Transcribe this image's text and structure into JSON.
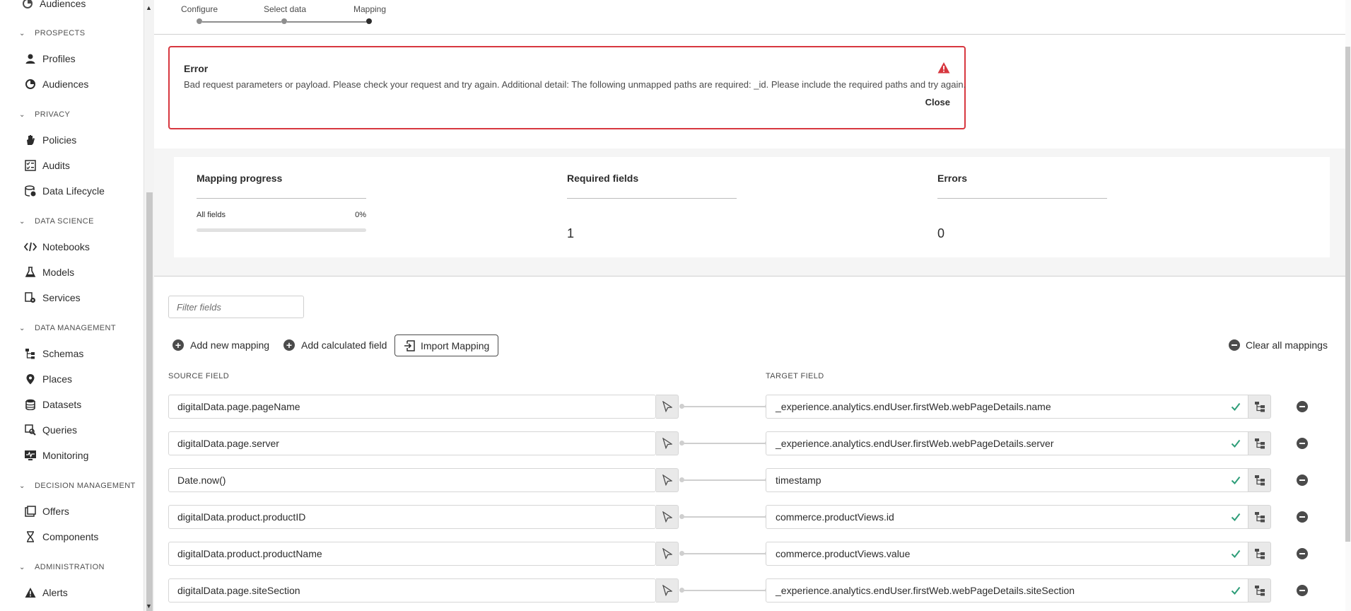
{
  "sidebar": {
    "top_item": "Audiences",
    "sections": [
      {
        "title": "PROSPECTS",
        "items": [
          "Profiles",
          "Audiences"
        ]
      },
      {
        "title": "PRIVACY",
        "items": [
          "Policies",
          "Audits",
          "Data Lifecycle"
        ]
      },
      {
        "title": "DATA SCIENCE",
        "items": [
          "Notebooks",
          "Models",
          "Services"
        ]
      },
      {
        "title": "DATA MANAGEMENT",
        "items": [
          "Schemas",
          "Places",
          "Datasets",
          "Queries",
          "Monitoring"
        ]
      },
      {
        "title": "DECISION MANAGEMENT",
        "items": [
          "Offers",
          "Components"
        ]
      },
      {
        "title": "ADMINISTRATION",
        "items": [
          "Alerts"
        ]
      }
    ]
  },
  "stepper": {
    "steps": [
      "Configure",
      "Select data",
      "Mapping"
    ],
    "active": "Mapping"
  },
  "error": {
    "title": "Error",
    "message": "Bad request parameters or payload. Please check your request and try again. Additional detail: The following unmapped paths are required: _id. Please include the required paths and try again.",
    "close_label": "Close"
  },
  "progress": {
    "mapping_title": "Mapping progress",
    "all_fields_label": "All fields",
    "all_fields_percent": "0%",
    "all_fields_fraction": 0,
    "required_title": "Required fields",
    "required_value": "1",
    "errors_title": "Errors",
    "errors_value": "0"
  },
  "filter": {
    "placeholder": "Filter fields"
  },
  "toolbar": {
    "add_mapping": "Add new mapping",
    "add_calculated": "Add calculated field",
    "import_mapping": "Import Mapping",
    "clear_all": "Clear all mappings"
  },
  "columns": {
    "source": "SOURCE FIELD",
    "target": "TARGET FIELD"
  },
  "mappings": [
    {
      "source": "digitalData.page.pageName",
      "target": "_experience.analytics.endUser.firstWeb.webPageDetails.name"
    },
    {
      "source": "digitalData.page.server",
      "target": "_experience.analytics.endUser.firstWeb.webPageDetails.server"
    },
    {
      "source": "Date.now()",
      "target": "timestamp"
    },
    {
      "source": "digitalData.product.productID",
      "target": "commerce.productViews.id"
    },
    {
      "source": "digitalData.product.productName",
      "target": "commerce.productViews.value"
    },
    {
      "source": "digitalData.page.siteSection",
      "target": "_experience.analytics.endUser.firstWeb.webPageDetails.siteSection"
    }
  ],
  "colors": {
    "error": "#d7373f",
    "check": "#2d9d78"
  }
}
